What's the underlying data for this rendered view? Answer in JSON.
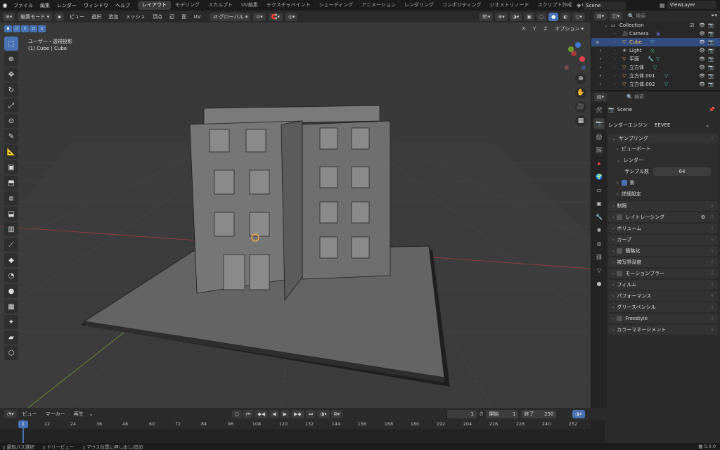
{
  "menu": [
    "ファイル",
    "編集",
    "レンダー",
    "ウィンドウ",
    "ヘルプ"
  ],
  "workspaces": [
    "レイアウト",
    "モデリング",
    "スカルプト",
    "UV編集",
    "テクスチャペイント",
    "シェーディング",
    "アニメーション",
    "レンダリング",
    "コンポジティング",
    "ジオメトリノード",
    "スクリプト作成"
  ],
  "workspace_add": "+",
  "scene_name": "Scene",
  "view_layer": "ViewLayer",
  "viewport_header": {
    "mode": "編集モード",
    "menus": [
      "ビュー",
      "選択",
      "追加",
      "メッシュ",
      "頂点",
      "辺",
      "面",
      "UV"
    ],
    "transform_orientation": "グローバル",
    "options_label": "オプション",
    "axis_labels": [
      "X",
      "Y",
      "Z"
    ]
  },
  "viewport_info": {
    "line1": "ユーザー・透視投影",
    "line2": "(1) Cube | Cube"
  },
  "nav_gizmo": {
    "x": "X",
    "y": "Y",
    "z": "Z"
  },
  "outliner": {
    "search_placeholder": "検索",
    "collection": "Collection",
    "items": [
      {
        "name": "Camera",
        "icon": "camera-icon",
        "color": "#cccccc"
      },
      {
        "name": "Cube",
        "icon": "mesh-icon",
        "color": "#e8a54b",
        "selected": true
      },
      {
        "name": "Light",
        "icon": "light-icon",
        "color": "#cccccc"
      },
      {
        "name": "平面",
        "icon": "mesh-icon",
        "color": "#e8a54b"
      },
      {
        "name": "立方体",
        "icon": "mesh-icon",
        "color": "#e8a54b"
      },
      {
        "name": "立方体.001",
        "icon": "mesh-icon",
        "color": "#e8a54b"
      },
      {
        "name": "立方体.002",
        "icon": "mesh-icon",
        "color": "#e8a54b"
      }
    ]
  },
  "properties": {
    "search_placeholder": "検索",
    "scene_label": "Scene",
    "render_engine_label": "レンダーエンジン",
    "render_engine_value": "EEVEE",
    "sampling": "サンプリング",
    "viewport": "ビューポート",
    "render": "レンダー",
    "samples_label": "サンプル数",
    "samples_value": "64",
    "shadows": "影",
    "advanced": "詳細設定",
    "panels": [
      "制限",
      "レイトレーシング",
      "ボリューム",
      "カーブ",
      "簡略化",
      "被写界深度",
      "モーションブラー",
      "フィルム",
      "パフォーマンス",
      "グリースペンシル",
      "Freestyle",
      "カラーマネージメント"
    ]
  },
  "timeline": {
    "menus": [
      "ビュー",
      "マーカー",
      "再生"
    ],
    "current_frame": "1",
    "start_label": "開始",
    "start_value": "1",
    "end_label": "終了",
    "end_value": "250",
    "ticks": [
      "1",
      "12",
      "24",
      "36",
      "48",
      "60",
      "72",
      "84",
      "96",
      "108",
      "120",
      "132",
      "144",
      "156",
      "168",
      "180",
      "192",
      "204",
      "216",
      "228",
      "240",
      "252"
    ]
  },
  "status": {
    "items": [
      "最短パス選択",
      "ドリービュー",
      "マウス位置に押し出し/追加"
    ],
    "version": "5.0.0"
  },
  "colors": {
    "accent": "#4772b3",
    "object": "#e8a54b",
    "grid_x": "#a63d3d",
    "grid_y": "#6c9a2e"
  }
}
